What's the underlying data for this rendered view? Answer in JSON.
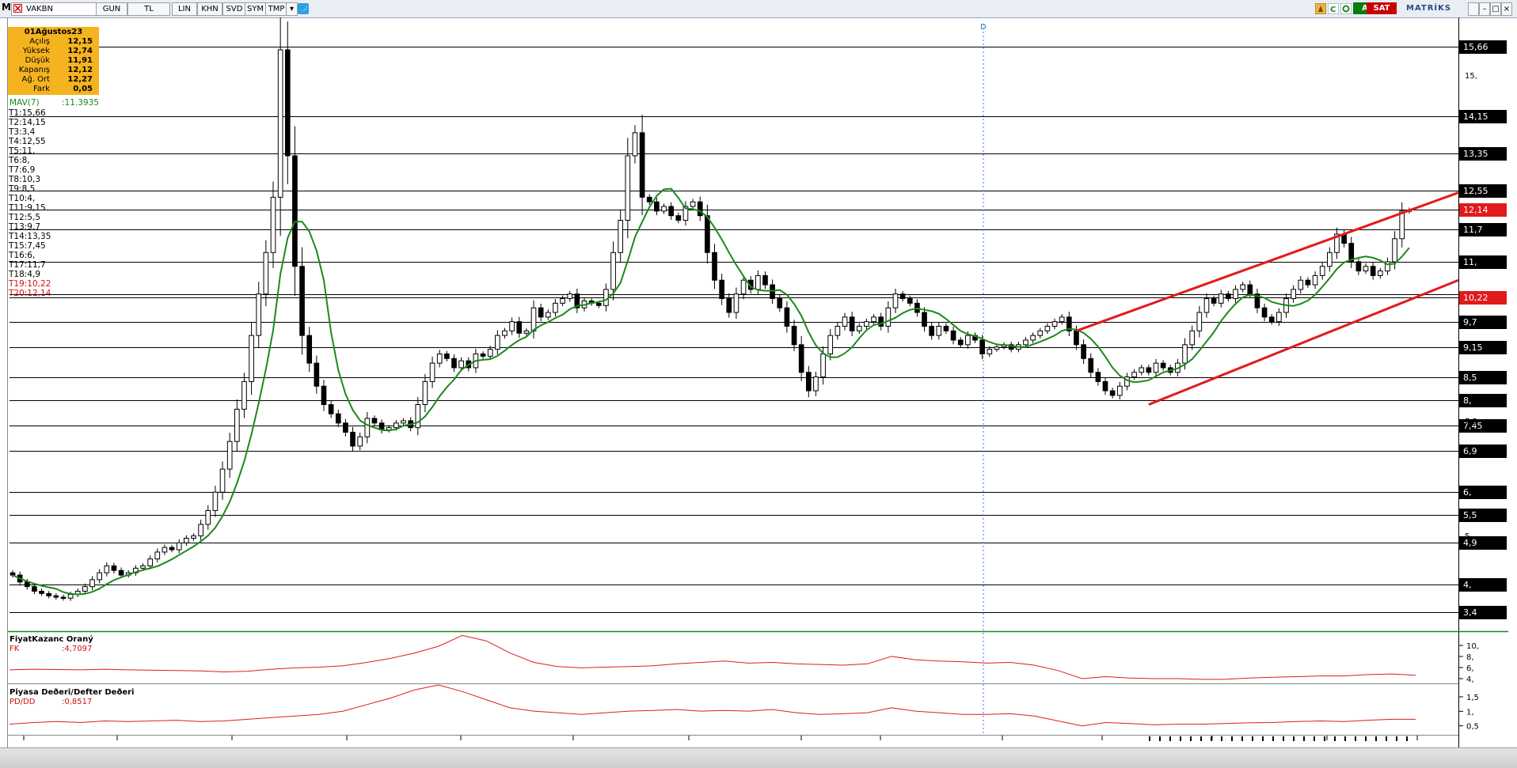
{
  "toolbar": {
    "symbol": "VAKBN",
    "buttons": [
      "GUN",
      "TL",
      "LIN",
      "KHN",
      "SVD",
      "SYM",
      "TMP"
    ],
    "buy": "AL",
    "sell": "SAT",
    "brand": "MATRİKS"
  },
  "ohlc": {
    "date": "01Ağustos23",
    "rows": [
      {
        "label": "Açılış",
        "value": "12,15"
      },
      {
        "label": "Yüksek",
        "value": "12,74"
      },
      {
        "label": "Düşük",
        "value": "11,91"
      },
      {
        "label": "Kapanış",
        "value": "12,12"
      },
      {
        "label": "Ağ. Ort",
        "value": "12,27"
      },
      {
        "label": "Fark",
        "value": "0,05"
      }
    ]
  },
  "mav": {
    "label": "MAV(7)",
    "value": ":11.3935"
  },
  "levels": [
    {
      "text": "T1:15,66",
      "value": 15.66,
      "color": "#000000"
    },
    {
      "text": "T2:14,15",
      "value": 14.15,
      "color": "#000000"
    },
    {
      "text": "T3:3,4",
      "value": 3.4,
      "color": "#000000"
    },
    {
      "text": "T4:12,55",
      "value": 12.55,
      "color": "#000000"
    },
    {
      "text": "T5:11,",
      "value": 11.0,
      "color": "#000000"
    },
    {
      "text": "T6:8,",
      "value": 8.0,
      "color": "#000000"
    },
    {
      "text": "T7:6,9",
      "value": 6.9,
      "color": "#000000"
    },
    {
      "text": "T8:10,3",
      "value": 10.3,
      "color": "#000000"
    },
    {
      "text": "T9:8,5",
      "value": 8.5,
      "color": "#000000"
    },
    {
      "text": "T10:4,",
      "value": 4.0,
      "color": "#000000"
    },
    {
      "text": "T11:9,15",
      "value": 9.15,
      "color": "#000000"
    },
    {
      "text": "T12:5,5",
      "value": 5.5,
      "color": "#000000"
    },
    {
      "text": "T13:9,7",
      "value": 9.7,
      "color": "#000000"
    },
    {
      "text": "T14:13,35",
      "value": 13.35,
      "color": "#000000"
    },
    {
      "text": "T15:7,45",
      "value": 7.45,
      "color": "#000000"
    },
    {
      "text": "T16:6,",
      "value": 6.0,
      "color": "#000000"
    },
    {
      "text": "T17:11,7",
      "value": 11.7,
      "color": "#000000"
    },
    {
      "text": "T18:4,9",
      "value": 4.9,
      "color": "#000000"
    },
    {
      "text": "T19:10,22",
      "value": 10.22,
      "color": "#d21010"
    },
    {
      "text": "T20:12,14",
      "value": 12.14,
      "color": "#d21010"
    }
  ],
  "price_tags": [
    {
      "text": "15,66",
      "value": 15.66,
      "red": false
    },
    {
      "text": "14,15",
      "value": 14.15,
      "red": false
    },
    {
      "text": "13,35",
      "value": 13.35,
      "red": false
    },
    {
      "text": "12,55",
      "value": 12.55,
      "red": false
    },
    {
      "text": "12,14",
      "value": 12.14,
      "red": true
    },
    {
      "text": "11,7",
      "value": 11.7,
      "red": false
    },
    {
      "text": "11,",
      "value": 11.0,
      "red": false
    },
    {
      "text": "10,22",
      "value": 10.22,
      "red": true
    },
    {
      "text": "9,7",
      "value": 9.7,
      "red": false
    },
    {
      "text": "9,15",
      "value": 9.15,
      "red": false
    },
    {
      "text": "8,5",
      "value": 8.5,
      "red": false
    },
    {
      "text": "8,",
      "value": 8.0,
      "red": false
    },
    {
      "text": "7,45",
      "value": 7.45,
      "red": false
    },
    {
      "text": "6,9",
      "value": 6.9,
      "red": false
    },
    {
      "text": "6,",
      "value": 6.0,
      "red": false
    },
    {
      "text": "5,5",
      "value": 5.5,
      "red": false
    },
    {
      "text": "4,9",
      "value": 4.9,
      "red": false
    },
    {
      "text": "4,",
      "value": 4.0,
      "red": false
    },
    {
      "text": "3,4",
      "value": 3.4,
      "red": false
    }
  ],
  "axis_ticks": [
    {
      "text": "15,",
      "value": 15.0
    },
    {
      "text": "7,5",
      "value": 7.5
    },
    {
      "text": "5,",
      "value": 5.0
    }
  ],
  "divider_label": "D",
  "indicators": {
    "pe": {
      "title": "FiyatKazanc Oraný",
      "sub": "FK",
      "value": ":4,7097",
      "ticks": [
        "10,",
        "8,",
        "6,",
        "4,"
      ]
    },
    "pb": {
      "title": "Piyasa Deðeri/Defter Deðeri",
      "sub": "PD/DD",
      "value": ":0,8517",
      "ticks": [
        "1,5",
        "1,",
        "0,5"
      ]
    }
  },
  "colors": {
    "candle_line": "#000000",
    "mav": "#1a8a1a",
    "channel": "#e11b1b",
    "indicator": "#e11b1b",
    "divider": "#2a7fd4"
  },
  "chart_data": {
    "type": "candlestick",
    "symbol": "VAKBN",
    "ylim": [
      3.0,
      16.2
    ],
    "channel": {
      "upper": [
        [
          147,
          9.5
        ],
        [
          199,
          12.5
        ]
      ],
      "lower": [
        [
          157,
          7.9
        ],
        [
          199,
          10.6
        ]
      ]
    },
    "mav_period": 7,
    "close": [
      4.2,
      4.05,
      3.95,
      3.85,
      3.8,
      3.75,
      3.72,
      3.7,
      3.78,
      3.85,
      3.95,
      4.1,
      4.25,
      4.4,
      4.3,
      4.2,
      4.25,
      4.35,
      4.4,
      4.55,
      4.7,
      4.8,
      4.75,
      4.9,
      5.0,
      5.05,
      5.3,
      5.6,
      6.0,
      6.5,
      7.1,
      7.8,
      8.4,
      9.4,
      10.3,
      11.2,
      12.4,
      15.6,
      13.3,
      10.9,
      9.4,
      8.8,
      8.3,
      7.9,
      7.7,
      7.5,
      7.3,
      7.0,
      7.2,
      7.6,
      7.5,
      7.35,
      7.4,
      7.5,
      7.55,
      7.4,
      7.9,
      8.4,
      8.8,
      9.0,
      8.9,
      8.7,
      8.85,
      8.7,
      9.0,
      8.95,
      9.1,
      9.4,
      9.5,
      9.7,
      9.45,
      9.5,
      10.0,
      9.8,
      9.9,
      10.1,
      10.2,
      10.3,
      10.0,
      10.15,
      10.1,
      10.05,
      10.4,
      11.2,
      11.9,
      13.3,
      13.8,
      12.4,
      12.3,
      12.1,
      12.2,
      12.0,
      11.9,
      12.2,
      12.3,
      12.0,
      11.2,
      10.6,
      10.2,
      9.9,
      10.3,
      10.6,
      10.4,
      10.7,
      10.5,
      10.2,
      10.0,
      9.6,
      9.2,
      8.6,
      8.2,
      8.5,
      9.0,
      9.4,
      9.6,
      9.8,
      9.5,
      9.6,
      9.7,
      9.8,
      9.6,
      10.0,
      10.3,
      10.2,
      10.1,
      9.9,
      9.6,
      9.4,
      9.6,
      9.5,
      9.3,
      9.2,
      9.4,
      9.3,
      9.0,
      9.1,
      9.15,
      9.2,
      9.1,
      9.2,
      9.3,
      9.4,
      9.5,
      9.6,
      9.7,
      9.8,
      9.5,
      9.2,
      8.9,
      8.6,
      8.4,
      8.2,
      8.1,
      8.3,
      8.5,
      8.6,
      8.7,
      8.6,
      8.8,
      8.7,
      8.6,
      8.8,
      9.2,
      9.5,
      9.9,
      10.2,
      10.1,
      10.3,
      10.2,
      10.4,
      10.5,
      10.3,
      10.0,
      9.8,
      9.7,
      9.9,
      10.2,
      10.4,
      10.6,
      10.5,
      10.7,
      10.9,
      11.2,
      11.6,
      11.4,
      11.0,
      10.8,
      10.9,
      10.7,
      10.8,
      11.0,
      11.5,
      12.1,
      12.12
    ],
    "pe": {
      "ylim": [
        3.5,
        11.0
      ],
      "values": [
        5.5,
        5.6,
        5.55,
        5.5,
        5.6,
        5.5,
        5.45,
        5.4,
        5.35,
        5.2,
        5.3,
        5.6,
        5.8,
        5.9,
        6.1,
        6.6,
        7.2,
        8.0,
        9.0,
        10.6,
        9.8,
        8.0,
        6.6,
        6.0,
        5.8,
        5.9,
        6.0,
        6.1,
        6.4,
        6.6,
        6.8,
        6.5,
        6.6,
        6.4,
        6.3,
        6.2,
        6.4,
        7.5,
        7.0,
        6.8,
        6.7,
        6.5,
        6.6,
        6.2,
        5.4,
        4.2,
        4.5,
        4.3,
        4.2,
        4.2,
        4.1,
        4.1,
        4.3,
        4.4,
        4.5,
        4.6,
        4.6,
        4.8,
        4.9,
        4.7
      ]
    },
    "pb": {
      "ylim": [
        0.4,
        1.9
      ],
      "values": [
        0.7,
        0.75,
        0.78,
        0.75,
        0.8,
        0.78,
        0.8,
        0.82,
        0.78,
        0.8,
        0.85,
        0.9,
        0.95,
        1.0,
        1.1,
        1.3,
        1.5,
        1.75,
        1.9,
        1.7,
        1.45,
        1.2,
        1.1,
        1.05,
        1.0,
        1.05,
        1.1,
        1.12,
        1.15,
        1.1,
        1.12,
        1.1,
        1.15,
        1.05,
        1.0,
        1.02,
        1.05,
        1.2,
        1.1,
        1.05,
        1.0,
        1.0,
        1.02,
        0.95,
        0.8,
        0.65,
        0.75,
        0.72,
        0.68,
        0.7,
        0.7,
        0.72,
        0.74,
        0.75,
        0.78,
        0.8,
        0.78,
        0.82,
        0.85,
        0.85
      ]
    }
  }
}
